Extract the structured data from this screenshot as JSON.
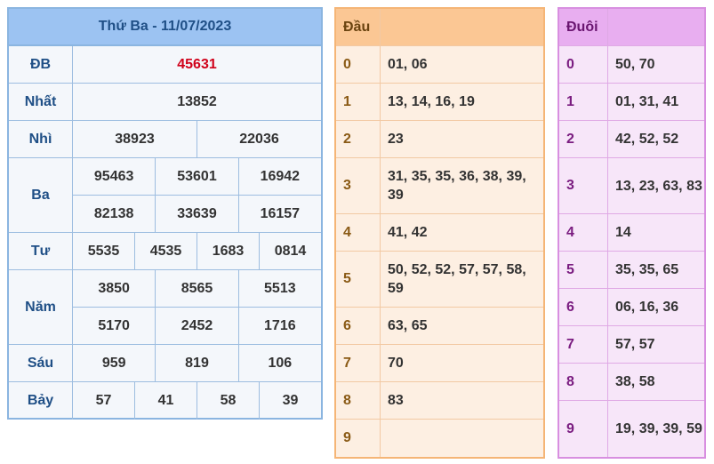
{
  "results": {
    "title": "Thứ Ba - 11/07/2023",
    "prizes": [
      {
        "label": "ĐB",
        "rows": [
          [
            "45631"
          ]
        ]
      },
      {
        "label": "Nhất",
        "rows": [
          [
            "13852"
          ]
        ]
      },
      {
        "label": "Nhì",
        "rows": [
          [
            "38923",
            "22036"
          ]
        ]
      },
      {
        "label": "Ba",
        "rows": [
          [
            "95463",
            "53601",
            "16942"
          ],
          [
            "82138",
            "33639",
            "16157"
          ]
        ]
      },
      {
        "label": "Tư",
        "rows": [
          [
            "5535",
            "4535",
            "1683",
            "0814"
          ]
        ]
      },
      {
        "label": "Năm",
        "rows": [
          [
            "3850",
            "8565",
            "5513"
          ],
          [
            "5170",
            "2452",
            "1716"
          ]
        ]
      },
      {
        "label": "Sáu",
        "rows": [
          [
            "959",
            "819",
            "106"
          ]
        ]
      },
      {
        "label": "Bảy",
        "rows": [
          [
            "57",
            "41",
            "58",
            "39"
          ]
        ]
      }
    ]
  },
  "dau": {
    "header": "Đầu",
    "rows": [
      {
        "key": "0",
        "value": "01, 06"
      },
      {
        "key": "1",
        "value": "13, 14, 16, 19"
      },
      {
        "key": "2",
        "value": "23"
      },
      {
        "key": "3",
        "value": "31, 35, 35, 36, 38, 39, 39"
      },
      {
        "key": "4",
        "value": "41, 42"
      },
      {
        "key": "5",
        "value": "50, 52, 52, 57, 57, 58, 59"
      },
      {
        "key": "6",
        "value": "63, 65"
      },
      {
        "key": "7",
        "value": "70"
      },
      {
        "key": "8",
        "value": "83"
      },
      {
        "key": "9",
        "value": ""
      }
    ]
  },
  "duoi": {
    "header": "Đuôi",
    "rows": [
      {
        "key": "0",
        "value": "50, 70"
      },
      {
        "key": "1",
        "value": "01, 31, 41"
      },
      {
        "key": "2",
        "value": "42, 52, 52"
      },
      {
        "key": "3",
        "value": "13, 23, 63, 83"
      },
      {
        "key": "4",
        "value": "14"
      },
      {
        "key": "5",
        "value": "35, 35, 65"
      },
      {
        "key": "6",
        "value": "06, 16, 36"
      },
      {
        "key": "7",
        "value": "57, 57"
      },
      {
        "key": "8",
        "value": "38, 58"
      },
      {
        "key": "9",
        "value": "19, 39, 39, 59"
      }
    ]
  },
  "colors": {
    "special_prize": "#d0021b",
    "results_header": "#9cc3f2",
    "dau_header": "#fbc794",
    "duoi_header": "#e8aef0"
  }
}
